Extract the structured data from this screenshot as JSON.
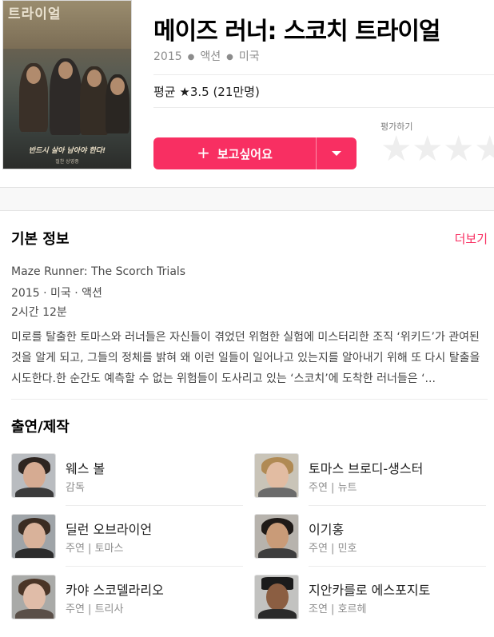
{
  "movie": {
    "title": "메이즈 러너: 스코치 트라이얼",
    "year": "2015",
    "genre": "액션",
    "country": "미국",
    "rating_text": "평균 ★3.5 (21만명)"
  },
  "poster": {
    "title_text": "트라이얼",
    "tagline": "반드시 살아 남아야 한다!",
    "subline": "절찬 상영중"
  },
  "actions": {
    "wish_label": "보고싶어요",
    "rate_label": "평가하기",
    "stars": [
      "★",
      "★",
      "★",
      "★"
    ]
  },
  "info": {
    "section_title": "기본 정보",
    "more_label": "더보기",
    "original_title": "Maze Runner: The Scorch Trials",
    "details": "2015 · 미국 · 액션",
    "runtime": "2시간 12분",
    "description": "미로를 탈출한 토마스와 러너들은 자신들이 겪었던 위험한 실험에 미스터리한 조직 ‘위키드’가 관여된 것을 알게 되고, 그들의 정체를 밝혀 왜 이런 일들이 일어나고 있는지를 알아내기 위해 또 다시 탈출을 시도한다.한 순간도 예측할 수 없는 위험들이 도사리고 있는 ‘스코치’에 도착한 러너들은 ‘..."
  },
  "cast": {
    "section_title": "출연/제작",
    "people": [
      {
        "name": "웨스 볼",
        "role": "감독"
      },
      {
        "name": "토마스 브로디-생스터",
        "role": "주연 | 뉴트"
      },
      {
        "name": "딜런 오브라이언",
        "role": "주연 | 토마스"
      },
      {
        "name": "이기홍",
        "role": "주연 | 민호"
      },
      {
        "name": "카야 스코델라리오",
        "role": "주연 | 트리사"
      },
      {
        "name": "지안카를로 에스포지토",
        "role": "조연 | 호르헤"
      }
    ]
  },
  "colors": {
    "accent": "#f82f62",
    "star_empty": "#eeeeee",
    "band": "#f8f8f8"
  }
}
